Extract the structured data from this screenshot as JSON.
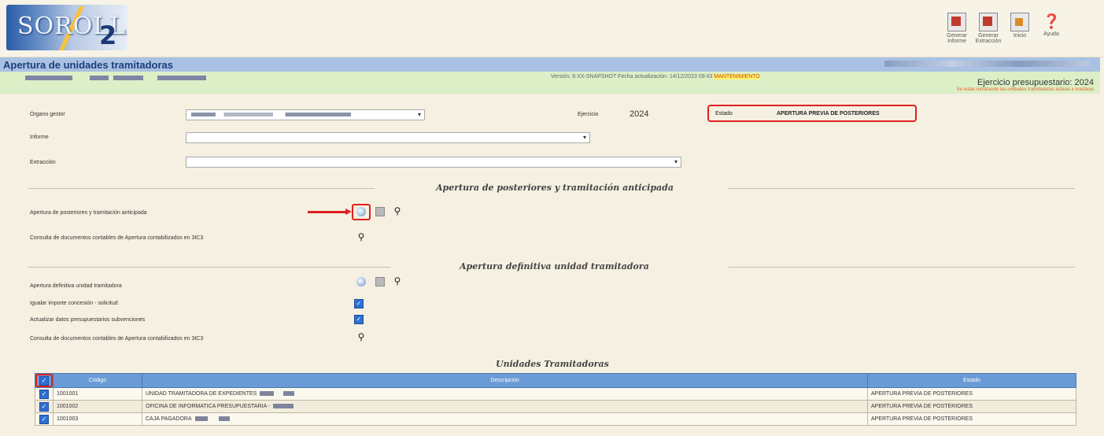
{
  "app": {
    "title": "Apertura de unidades tramitadoras",
    "logo_text": "SOROLLA",
    "logo_version": "2"
  },
  "toolbar": {
    "generar_informe": "Generar Informe",
    "generar_extraccion": "Generar Extracción",
    "inicio": "Inicio",
    "ayuda": "Ayuda"
  },
  "info": {
    "version_text": "Versión: 8.XX-SNAPSHOT Fecha actualización: 14/12/2023 09:43",
    "maint_label": "MANTENIMIENTO",
    "ejercicio_presupuestario": "Ejercicio presupuestario: 2024",
    "warning": "Se están mostrando las unidades tramitadoras activas e inactivas"
  },
  "form": {
    "organo_label": "Órgano gestor",
    "ejercicio_label": "Ejercicio",
    "ejercicio_value": "2024",
    "estado_label": "Estado",
    "estado_value": "APERTURA PREVIA DE POSTERIORES",
    "informe_label": "Informe",
    "extraccion_label": "Extracción"
  },
  "sections": {
    "s1_title": "Apertura de posteriores y tramitación anticipada",
    "s1_row1": "Apertura de posteriores y tramitación anticipada",
    "s1_row2": "Consulta de documentos contables de Apertura contabilizados en 3IC3",
    "s2_title": "Apertura definitiva unidad tramitadora",
    "s2_row1": "Apertura definitiva unidad tramitadora",
    "s2_row2": "Igualar importe concesión - solicitud",
    "s2_row3": "Actualizar datos presupuestarios subvenciones",
    "s2_row4": "Consulta de documentos contables de Apertura contabilizados en 3IC3",
    "s3_title": "Unidades Tramitadoras"
  },
  "table": {
    "headers": [
      "Código",
      "Descripción",
      "Estado"
    ],
    "rows": [
      {
        "codigo": "1001001",
        "descripcion": "UNIDAD TRAMITADORA DE EXPEDIENTES",
        "estado": "APERTURA PREVIA DE POSTERIORES"
      },
      {
        "codigo": "1001002",
        "descripcion": "OFICINA DE INFORMATICA PRESUPUESTARIA -",
        "estado": "APERTURA PREVIA DE POSTERIORES"
      },
      {
        "codigo": "1001003",
        "descripcion": "CAJA PAGADORA",
        "estado": "APERTURA PREVIA DE POSTERIORES"
      }
    ]
  },
  "icons": {
    "radio": "radio-icon",
    "gray": "document-icon",
    "binoculars": "binoculars-icon",
    "checkbox": "checkbox-icon"
  }
}
